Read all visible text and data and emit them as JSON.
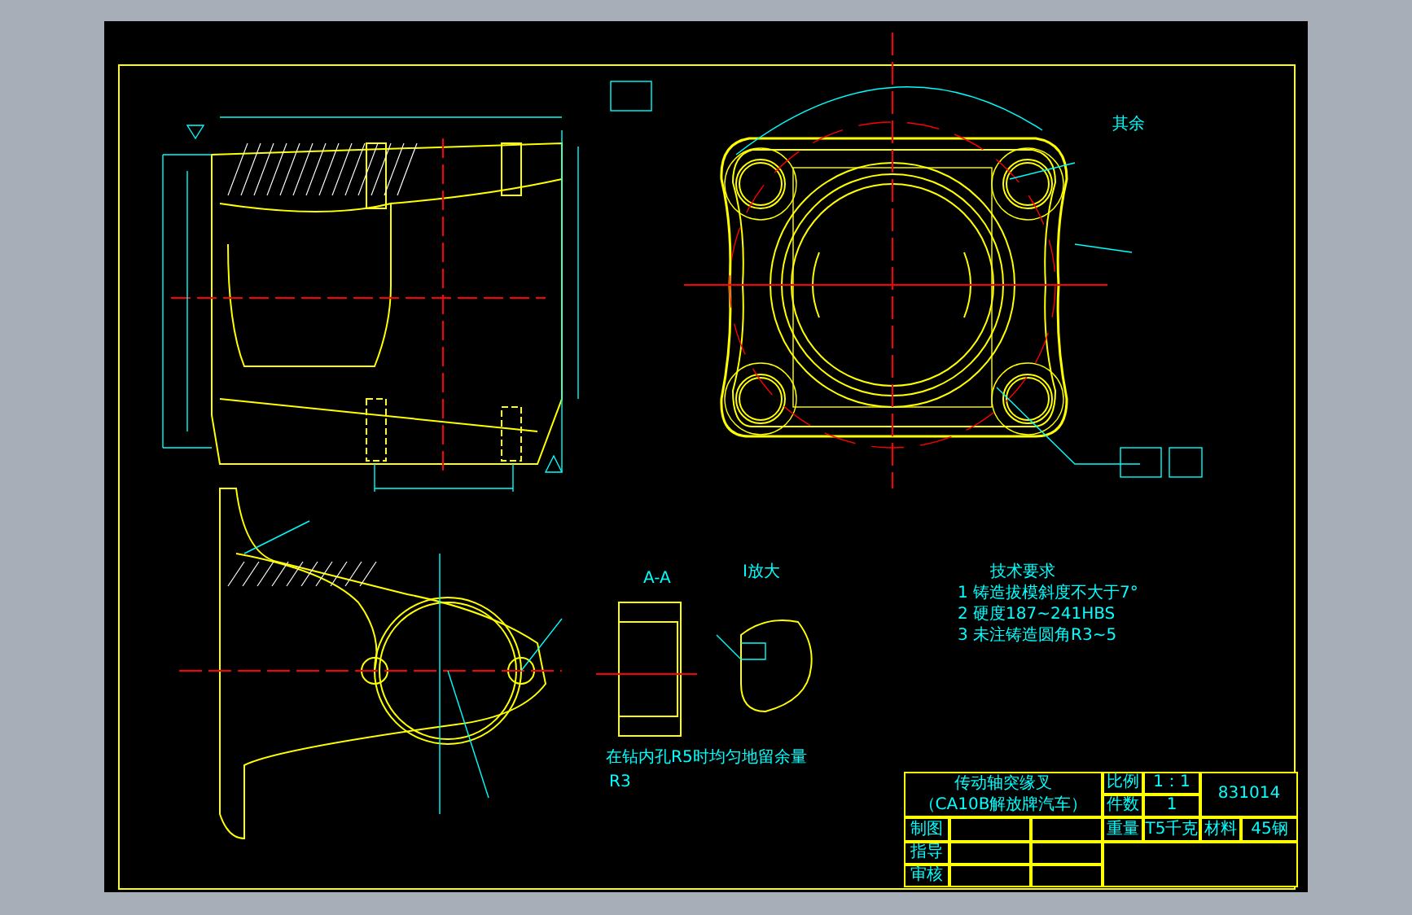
{
  "sheet": {
    "notes": [
      {
        "kind": "roughness",
        "text": "其余"
      },
      {
        "kind": "detail",
        "text": "I放大"
      },
      {
        "kind": "section",
        "text": "A-A"
      },
      {
        "kind": "remark",
        "text": "在钻内孔R5时均匀地留余量"
      },
      {
        "kind": "radius",
        "text": "R3"
      }
    ],
    "technical_requirements": {
      "title": "技术要求",
      "items": [
        "1 铸造拔模斜度不大于7°",
        "2 硬度187~241HBS",
        "3 未注铸造圆角R3~5"
      ]
    }
  },
  "title_block": {
    "part_name": "传动轴突缘叉",
    "vehicle": "（CA10B解放牌汽车）",
    "drawing_number": "831014",
    "fields": [
      {
        "label": "比例",
        "value": "1：1"
      },
      {
        "label": "件数",
        "value": "1"
      },
      {
        "label": "重量",
        "value": "T5千克"
      },
      {
        "label": "材料",
        "value": "45钢"
      }
    ],
    "roles": [
      "制图",
      "指导",
      "审核"
    ]
  }
}
